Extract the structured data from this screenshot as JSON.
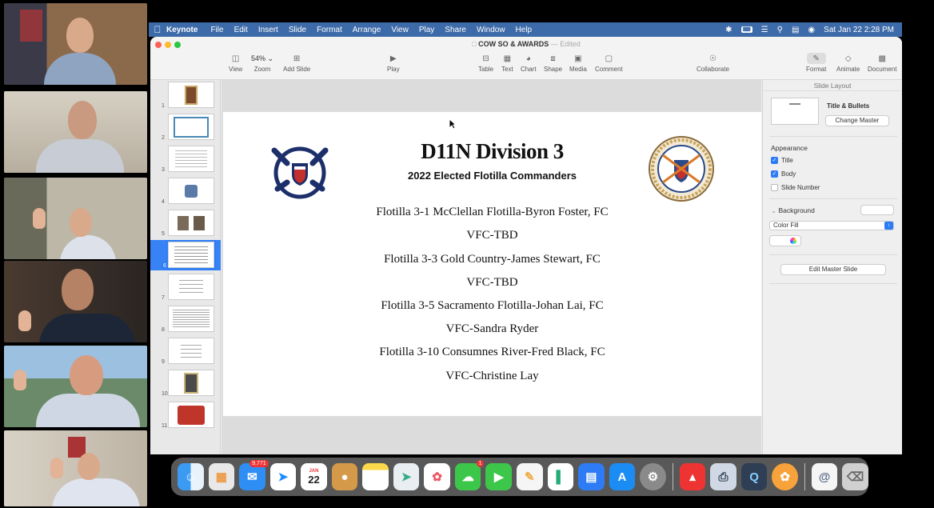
{
  "menubar": {
    "app_name": "Keynote",
    "menus": [
      "File",
      "Edit",
      "Insert",
      "Slide",
      "Format",
      "Arrange",
      "View",
      "Play",
      "Share",
      "Window",
      "Help"
    ],
    "datetime": "Sat Jan 22  2:28 PM"
  },
  "window": {
    "doc_title": "COW SO & AWARDS",
    "edited_label": "— Edited"
  },
  "toolbar": {
    "view": "View",
    "zoom_value": "54%",
    "zoom": "Zoom",
    "add_slide": "Add Slide",
    "play": "Play",
    "table": "Table",
    "text": "Text",
    "chart": "Chart",
    "shape": "Shape",
    "media": "Media",
    "comment": "Comment",
    "collaborate": "Collaborate",
    "format": "Format",
    "animate": "Animate",
    "document": "Document"
  },
  "slide_nav": {
    "numbers": [
      "1",
      "2",
      "3",
      "4",
      "5",
      "6",
      "7",
      "8",
      "9",
      "10",
      "11"
    ],
    "selected": "6"
  },
  "slide": {
    "title": "D11N Division 3",
    "subtitle": "2022 Elected Flotilla Commanders",
    "lines": [
      "Flotilla 3-1 McClellan Flotilla-Byron Foster, FC",
      "VFC-TBD",
      "Flotilla 3-3 Gold Country-James Stewart, FC",
      "VFC-TBD",
      "Flotilla 3-5 Sacramento Flotilla-Johan Lai, FC",
      "VFC-Sandra Ryder",
      "Flotilla 3-10 Consumnes River-Fred Black, FC",
      "VFC-Christine Lay"
    ]
  },
  "inspector": {
    "header": "Slide Layout",
    "master_name": "Title & Bullets",
    "change_master": "Change Master",
    "appearance": "Appearance",
    "title_cb": "Title",
    "body_cb": "Body",
    "slide_number_cb": "Slide Number",
    "background": "Background",
    "fill_select": "Color Fill",
    "edit_master": "Edit Master Slide"
  },
  "dock": {
    "mail_badge": "9,771",
    "calendar_month": "JAN",
    "calendar_day": "22",
    "messages_badge": "1"
  },
  "colors": {
    "menubar": "#3d6aa8",
    "accent": "#2d7cf6"
  }
}
